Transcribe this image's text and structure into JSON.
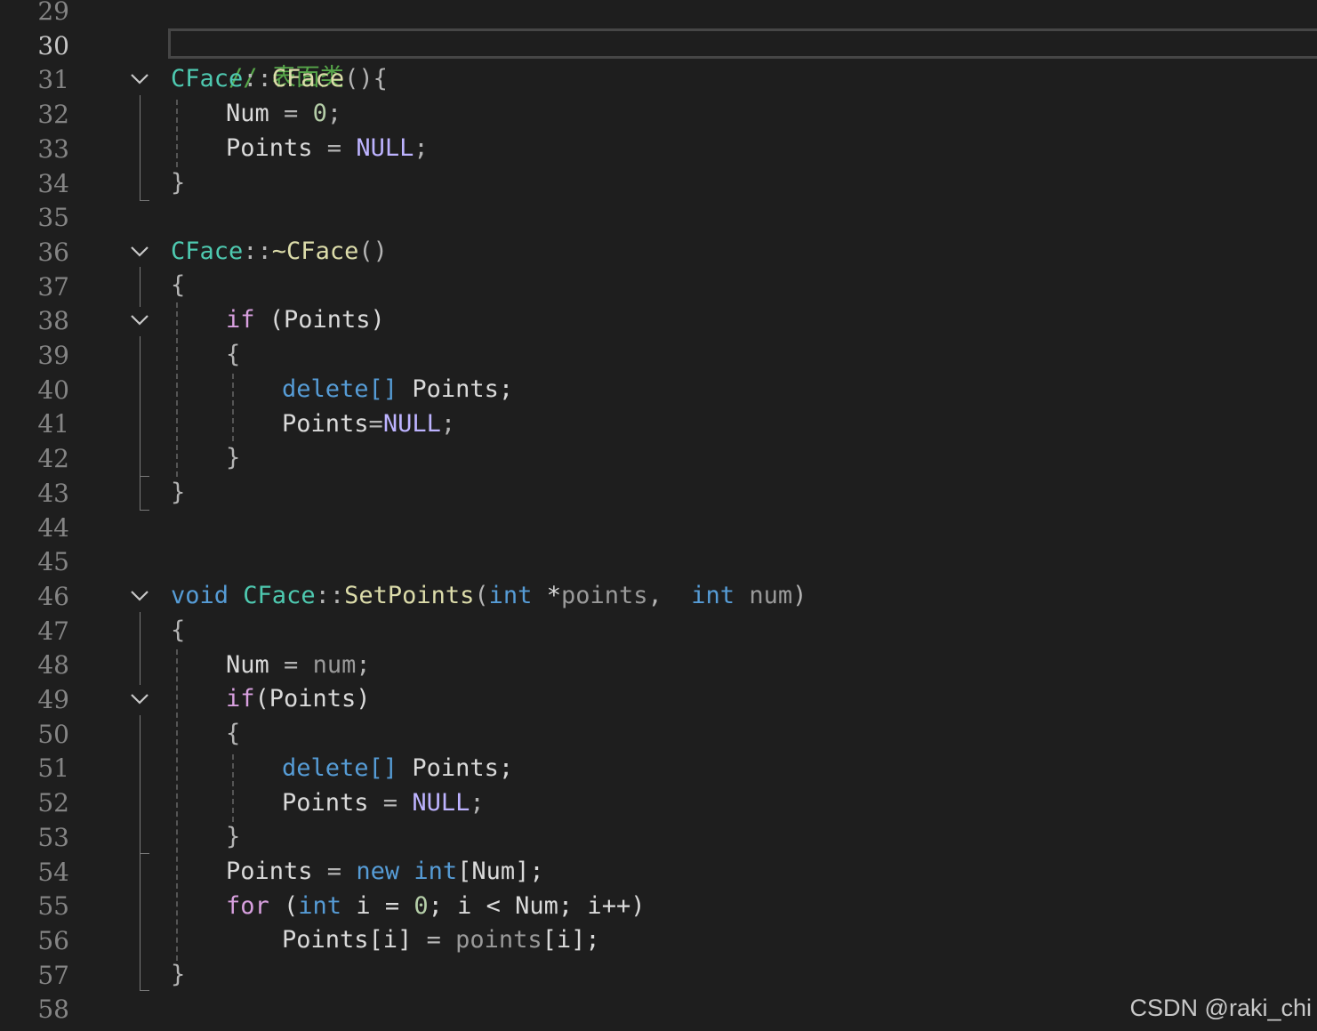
{
  "editor": {
    "current_line": "30",
    "line_numbers": [
      "29",
      "30",
      "31",
      "32",
      "33",
      "34",
      "35",
      "36",
      "37",
      "38",
      "39",
      "40",
      "41",
      "42",
      "43",
      "44",
      "45",
      "46",
      "47",
      "48",
      "49",
      "50",
      "51",
      "52",
      "53",
      "54",
      "55",
      "56",
      "57",
      "58"
    ],
    "lines": {
      "l30": {
        "comment": "// 表面类"
      },
      "l31": {
        "class": "CFace",
        "sep": "::",
        "func": "CFace",
        "rest": "(){"
      },
      "l32": {
        "member": "Num",
        "op": " = ",
        "num": "0",
        "end": ";"
      },
      "l33": {
        "member": "Points",
        "op": " = ",
        "macro": "NULL",
        "end": ";"
      },
      "l34": {
        "text": "}"
      },
      "l36": {
        "class": "CFace",
        "sep": "::",
        "func": "~CFace",
        "rest": "()"
      },
      "l37": {
        "text": "{"
      },
      "l38": {
        "kw": "if",
        "rest": " (Points)"
      },
      "l39": {
        "text": "{"
      },
      "l40": {
        "kw": "delete",
        "brackets": "[]",
        "rest": " Points;"
      },
      "l41": {
        "member": "Points",
        "op": "=",
        "macro": "NULL",
        "end": ";"
      },
      "l42": {
        "text": "}"
      },
      "l43": {
        "text": "}"
      },
      "l46": {
        "kw": "void",
        "class": "CFace",
        "sep": "::",
        "func": "SetPoints",
        "open": "(",
        "type1": "int",
        "star": " *",
        "param1": "points",
        "comma": ", ",
        "type2": "int",
        "param2": "num",
        "close": ")"
      },
      "l47": {
        "text": "{"
      },
      "l48": {
        "member": "Num",
        "op": " = ",
        "param": "num",
        "end": ";"
      },
      "l49": {
        "kw": "if",
        "rest": "(Points)"
      },
      "l50": {
        "text": "{"
      },
      "l51": {
        "kw": "delete",
        "brackets": "[]",
        "rest": " Points;"
      },
      "l52": {
        "member": "Points",
        "op": " = ",
        "macro": "NULL",
        "end": ";"
      },
      "l53": {
        "text": "}"
      },
      "l54": {
        "member": "Points",
        "op": " = ",
        "kw": "new",
        "type": "int",
        "rest": "[Num];"
      },
      "l55": {
        "kw": "for",
        "open": " (",
        "type": "int",
        "rest1": " i = ",
        "num": "0",
        "rest2": "; i < Num; i++)"
      },
      "l56": {
        "member": "Points",
        "rest1": "[i]",
        "op": " = ",
        "param": "points",
        "rest2": "[i];"
      },
      "l57": {
        "text": "}"
      }
    }
  },
  "watermark": "CSDN @raki_chi",
  "colors": {
    "background": "#1e1e1e",
    "comment": "#57a64a",
    "type": "#4ec9b0",
    "function": "#dcdcaa",
    "keyword": "#569cd6",
    "control": "#d8a0df",
    "macro": "#bdb3ff",
    "number": "#b5cea8",
    "parameter": "#9a9a9a"
  },
  "icons": {
    "fold": "chevron-down-icon"
  }
}
